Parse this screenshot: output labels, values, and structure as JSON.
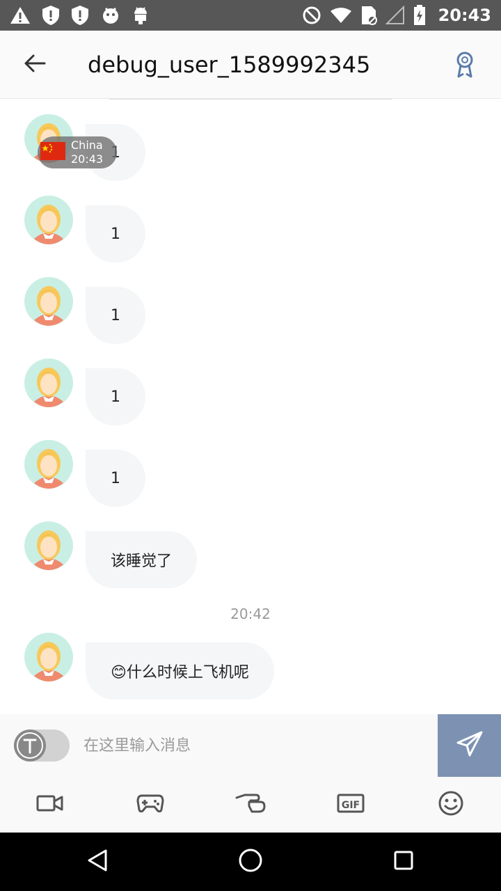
{
  "status_bar": {
    "time": "20:43",
    "left_icons": [
      "warning-icon",
      "shield-alert-icon",
      "shield-alert-icon",
      "bird-icon",
      "android-icon"
    ],
    "right_icons": [
      "do-not-disturb-icon",
      "wifi-icon",
      "sim-icon",
      "signal-icon",
      "battery-icon"
    ]
  },
  "header": {
    "title": "debug_user_1589992345",
    "back_icon": "arrow-left-icon",
    "badge_icon": "award-icon"
  },
  "chat": {
    "geo_tag": {
      "country": "China",
      "time": "20:43",
      "flag": "china-flag"
    },
    "messages": [
      {
        "text": "1"
      },
      {
        "text": "1"
      },
      {
        "text": "1"
      },
      {
        "text": "1"
      },
      {
        "text": "1"
      },
      {
        "text": "该睡觉了"
      },
      {
        "text": "😊什么时候上飞机呢"
      }
    ],
    "timestamp": "20:42"
  },
  "input": {
    "placeholder": "在这里输入消息",
    "translate_icon": "translate-t-icon",
    "send_icon": "paper-plane-icon"
  },
  "actions": {
    "items": [
      "video-icon",
      "gamepad-icon",
      "gift-hand-icon",
      "gif-icon",
      "emoji-smile-icon"
    ],
    "gif_label": "GIF"
  },
  "colors": {
    "status_bar": "#575757",
    "send_button": "#7d92b3",
    "bubble": "#f4f6f8",
    "avatar_bg": "#c9efe4",
    "accent": "#5a7ba8"
  }
}
